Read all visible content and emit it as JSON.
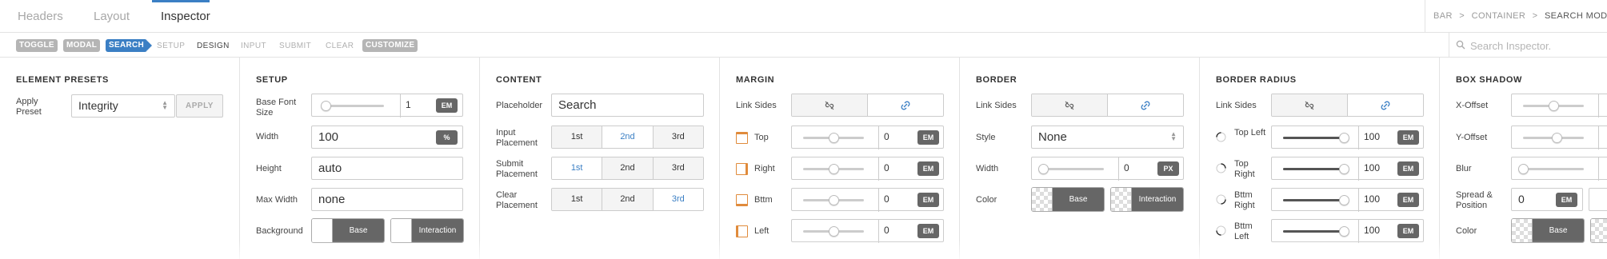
{
  "top_tabs": [
    {
      "label": "Headers"
    },
    {
      "label": "Layout"
    },
    {
      "label": "Inspector"
    }
  ],
  "breadcrumb": {
    "items": [
      "BAR",
      "CONTAINER"
    ],
    "current": "SEARCH MODAL",
    "separator": ">"
  },
  "sub_nav": {
    "pills": [
      "TOGGLE",
      "MODAL",
      "SEARCH"
    ],
    "steps": [
      "SETUP",
      "DESIGN",
      "INPUT",
      "SUBMIT",
      "CLEAR"
    ],
    "customize": "CUSTOMIZE"
  },
  "search": {
    "placeholder": "Search Inspector."
  },
  "element_presets": {
    "title": "ELEMENT PRESETS",
    "apply_preset_label": "Apply Preset",
    "preset_value": "Integrity",
    "apply_button": "APPLY"
  },
  "setup": {
    "title": "SETUP",
    "base_font_size": {
      "label": "Base Font Size",
      "value": "1",
      "unit": "EM",
      "slider_level": 0.04
    },
    "width": {
      "label": "Width",
      "value": "100",
      "unit": "%"
    },
    "height": {
      "label": "Height",
      "value": "auto"
    },
    "max_width": {
      "label": "Max Width",
      "value": "none"
    },
    "background": {
      "label": "Background",
      "base": "Base",
      "interaction": "Interaction"
    }
  },
  "content": {
    "title": "CONTENT",
    "placeholder": {
      "label": "Placeholder",
      "value": "Search"
    },
    "options": [
      "1st",
      "2nd",
      "3rd"
    ],
    "input_placement": {
      "label": "Input Placement",
      "selected": "2nd"
    },
    "submit_placement": {
      "label": "Submit Placement",
      "selected": "1st"
    },
    "clear_placement": {
      "label": "Clear Placement",
      "selected": "3rd"
    }
  },
  "margin": {
    "title": "MARGIN",
    "link_sides_label": "Link Sides",
    "rows": [
      {
        "label": "Top",
        "value": "0",
        "unit": "EM",
        "slider_level": 0.5
      },
      {
        "label": "Right",
        "value": "0",
        "unit": "EM",
        "slider_level": 0.5
      },
      {
        "label": "Bttm",
        "value": "0",
        "unit": "EM",
        "slider_level": 0.5
      },
      {
        "label": "Left",
        "value": "0",
        "unit": "EM",
        "slider_level": 0.5
      }
    ]
  },
  "border": {
    "title": "BORDER",
    "link_sides_label": "Link Sides",
    "style": {
      "label": "Style",
      "value": "None"
    },
    "width": {
      "label": "Width",
      "value": "0",
      "unit": "PX",
      "slider_level": 0.0
    },
    "color": {
      "label": "Color",
      "base": "Base",
      "interaction": "Interaction"
    }
  },
  "border_radius": {
    "title": "BORDER RADIUS",
    "link_sides_label": "Link Sides",
    "rows": [
      {
        "label": "Top Left",
        "value": "100",
        "unit": "EM",
        "slider_level": 1.0
      },
      {
        "label": "Top Right",
        "value": "100",
        "unit": "EM",
        "slider_level": 1.0
      },
      {
        "label": "Bttm Right",
        "value": "100",
        "unit": "EM",
        "slider_level": 1.0
      },
      {
        "label": "Bttm Left",
        "value": "100",
        "unit": "EM",
        "slider_level": 1.0
      }
    ]
  },
  "box_shadow": {
    "title": "BOX SHADOW",
    "x_offset": {
      "label": "X-Offset",
      "slider_level": 0.5
    },
    "y_offset": {
      "label": "Y-Offset",
      "slider_level": 0.55
    },
    "blur": {
      "label": "Blur",
      "slider_level": 0.0
    },
    "spread": {
      "label": "Spread & Position",
      "value": "0",
      "unit": "EM"
    },
    "color": {
      "label": "Color",
      "base": "Base"
    }
  },
  "colors": {
    "accent": "#3b7fc4",
    "margin_icon": "#e08b3c",
    "unit_bg": "#666666",
    "pill_grey": "#b5b5b5"
  }
}
